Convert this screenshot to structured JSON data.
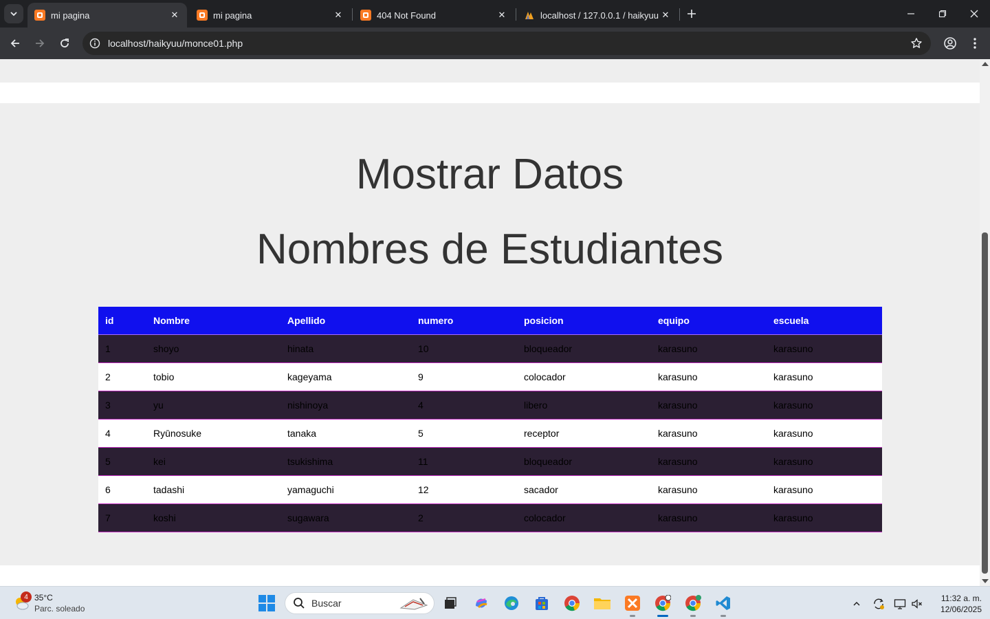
{
  "browser": {
    "tabs": [
      {
        "label": "mi pagina",
        "active": true,
        "icon": "xampp-icon"
      },
      {
        "label": "mi pagina",
        "active": false,
        "icon": "xampp-icon"
      },
      {
        "label": "404 Not Found",
        "active": false,
        "icon": "xampp-icon"
      },
      {
        "label": "localhost / 127.0.0.1 / haikyuu /",
        "active": false,
        "icon": "phpmyadmin-icon"
      }
    ],
    "url": "localhost/haikyuu/monce01.php"
  },
  "page": {
    "title": "Mostrar Datos",
    "subtitle": "Nombres de Estudiantes",
    "colors": {
      "header_bg": "#1010ee",
      "dark_row": "#2b1f33",
      "light_row": "#ffffff",
      "row_border": "#c22cc2"
    },
    "table": {
      "headers": [
        "id",
        "Nombre",
        "Apellido",
        "numero",
        "posicion",
        "equipo",
        "escuela"
      ],
      "rows": [
        [
          "1",
          "shoyo",
          "hinata",
          "10",
          "bloqueador",
          "karasuno",
          "karasuno"
        ],
        [
          "2",
          "tobio",
          "kageyama",
          "9",
          "colocador",
          "karasuno",
          "karasuno"
        ],
        [
          "3",
          "yu",
          "nishinoya",
          "4",
          "libero",
          "karasuno",
          "karasuno"
        ],
        [
          "4",
          "Ryūnosuke",
          "tanaka",
          "5",
          "receptor",
          "karasuno",
          "karasuno"
        ],
        [
          "5",
          "kei",
          "tsukishima",
          "11",
          "bloqueador",
          "karasuno",
          "karasuno"
        ],
        [
          "6",
          "tadashi",
          "yamaguchi",
          "12",
          "sacador",
          "karasuno",
          "karasuno"
        ],
        [
          "7",
          "koshi",
          "sugawara",
          "2",
          "colocador",
          "karasuno",
          "karasuno"
        ]
      ]
    }
  },
  "taskbar": {
    "weather": {
      "badge": "4",
      "temp": "35°C",
      "condition": "Parc. soleado"
    },
    "search_placeholder": "Buscar",
    "clock": {
      "time": "11:32 a. m.",
      "date": "12/06/2025"
    }
  }
}
